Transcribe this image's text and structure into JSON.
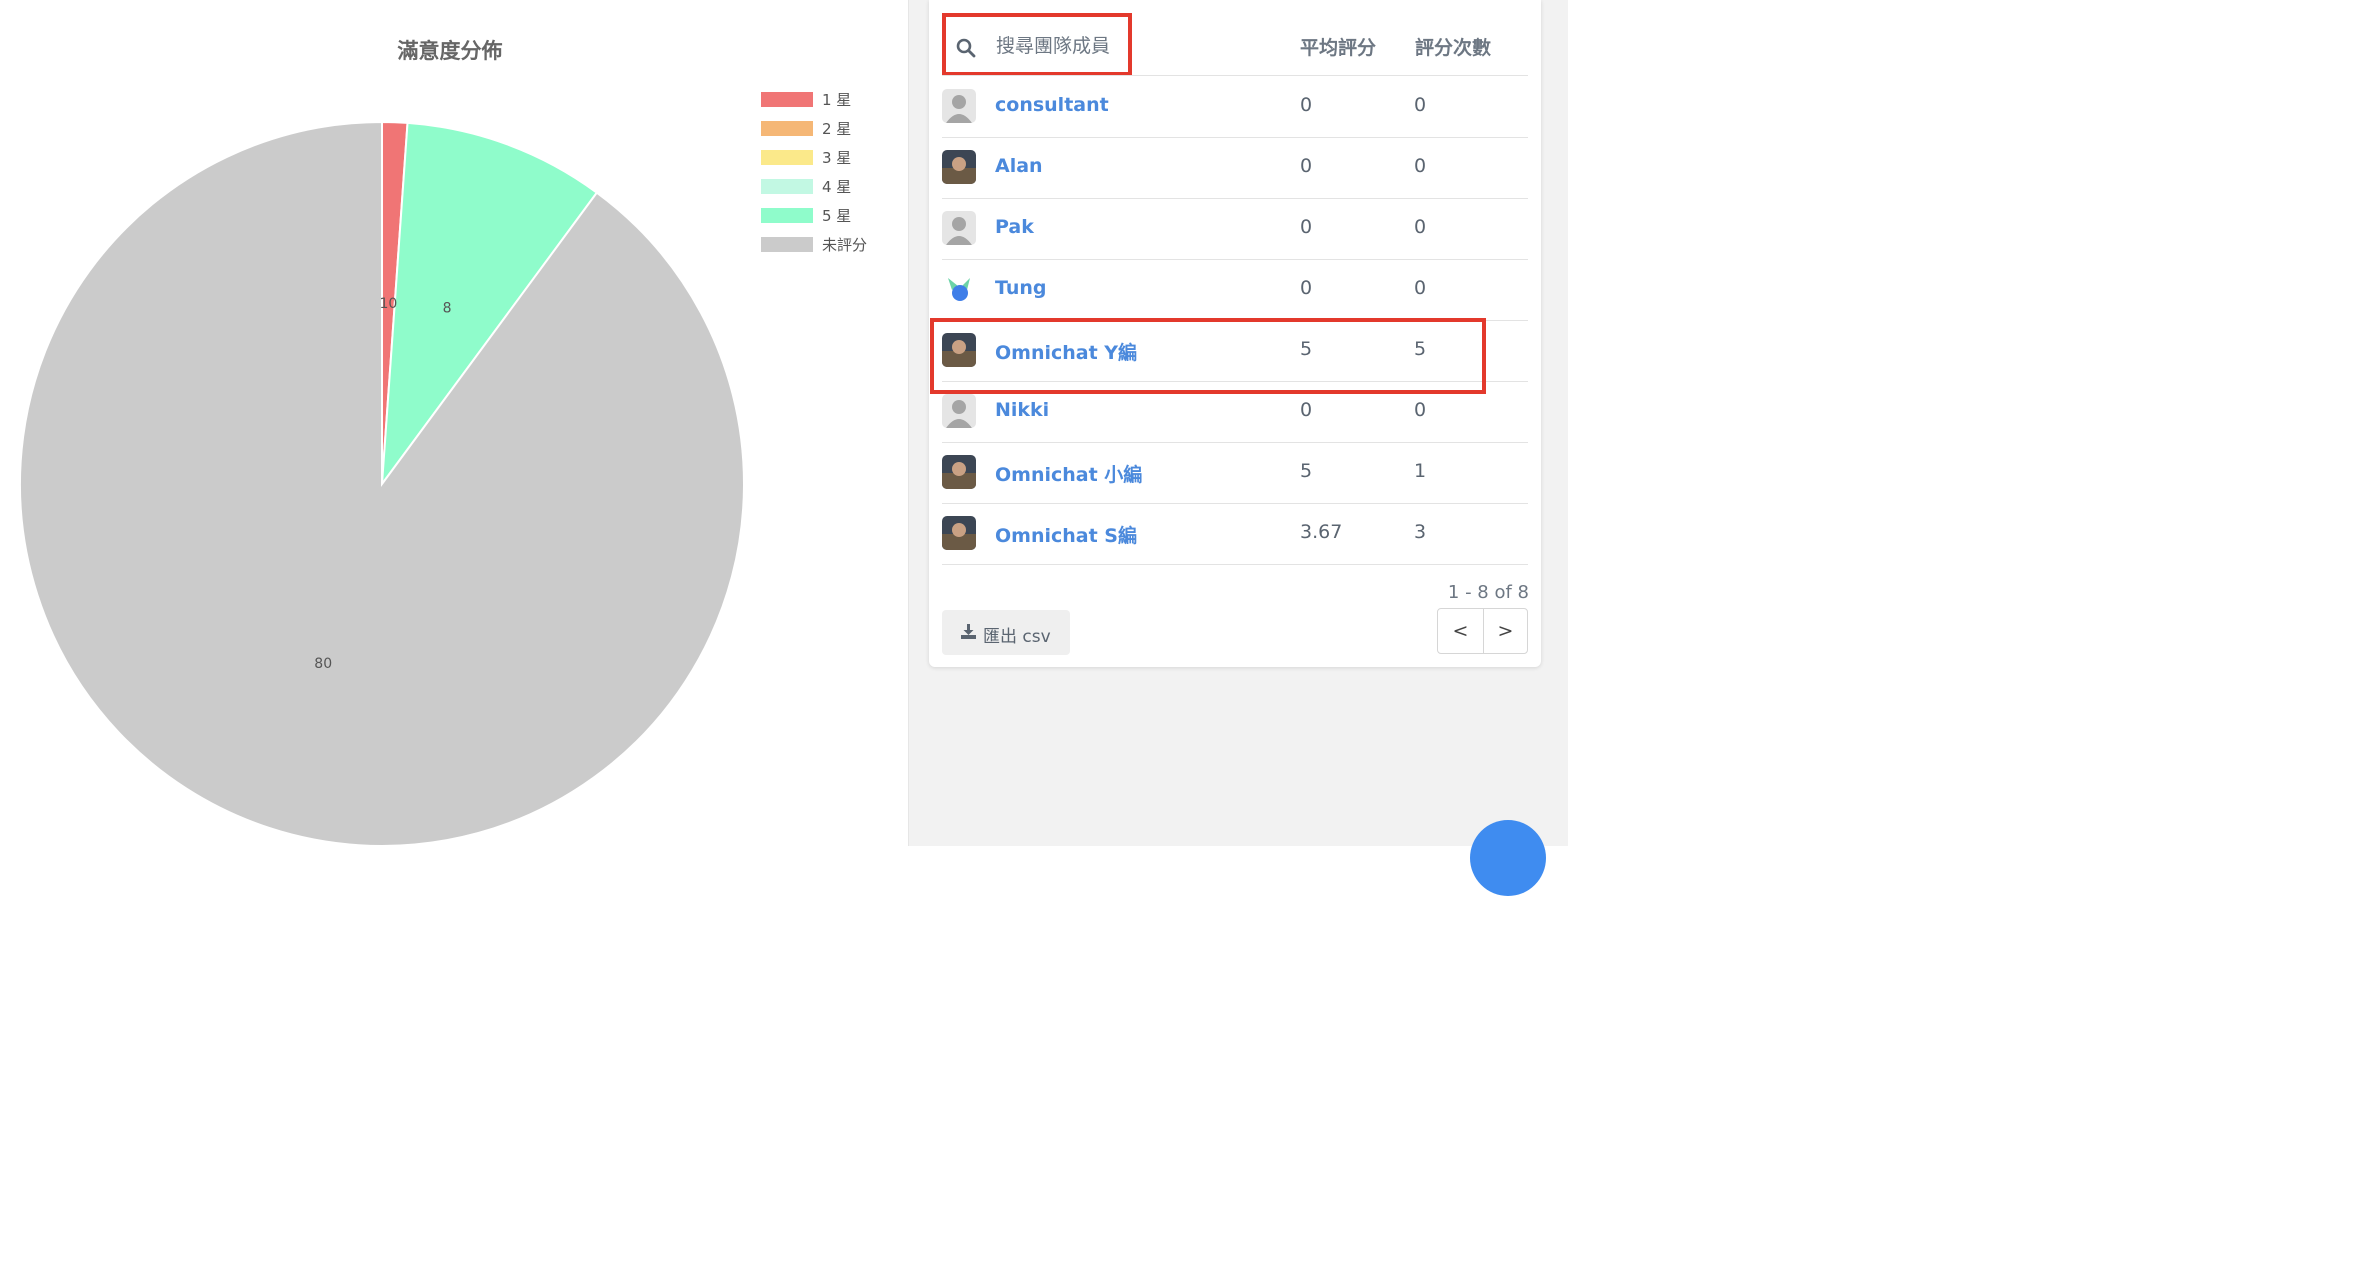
{
  "chart_data": {
    "type": "pie",
    "title": "滿意度分佈",
    "categories": [
      "1 星",
      "2 星",
      "3 星",
      "4 星",
      "5 星",
      "未評分"
    ],
    "values": [
      1,
      0,
      0,
      0,
      8,
      80
    ],
    "slice_labels": [
      "10",
      "",
      "",
      "",
      "8",
      "80"
    ],
    "colors": [
      "#f07575",
      "#f5b776",
      "#fbe98a",
      "#c2f8e3",
      "#8ffccb",
      "#cbcbcb"
    ],
    "legend_position": "top-right"
  },
  "team_table": {
    "search_placeholder": "搜尋團隊成員",
    "search_icon": "search-icon",
    "columns": {
      "avg": "平均評分",
      "count": "評分次數"
    },
    "rows": [
      {
        "name": "consultant",
        "avg": "0",
        "count": "0",
        "avatar": "default-user-icon"
      },
      {
        "name": "Alan",
        "avg": "0",
        "count": "0",
        "avatar": "photo-avatar"
      },
      {
        "name": "Pak",
        "avg": "0",
        "count": "0",
        "avatar": "default-user-icon"
      },
      {
        "name": "Tung",
        "avg": "0",
        "count": "0",
        "avatar": "logo-avatar"
      },
      {
        "name": "Omnichat Y編",
        "avg": "5",
        "count": "5",
        "avatar": "photo-avatar"
      },
      {
        "name": "Nikki",
        "avg": "0",
        "count": "0",
        "avatar": "default-user-icon"
      },
      {
        "name": "Omnichat 小編",
        "avg": "5",
        "count": "1",
        "avatar": "photo-avatar"
      },
      {
        "name": "Omnichat S編",
        "avg": "3.67",
        "count": "3",
        "avatar": "photo-avatar"
      }
    ],
    "pagination": {
      "range_text": "1 - 8 of 8",
      "prev_label": "<",
      "next_label": ">"
    },
    "export_label": "匯出 csv",
    "export_icon": "download-icon"
  },
  "colors": {
    "accent": "#4b89dc",
    "highlight": "#e3392c"
  }
}
